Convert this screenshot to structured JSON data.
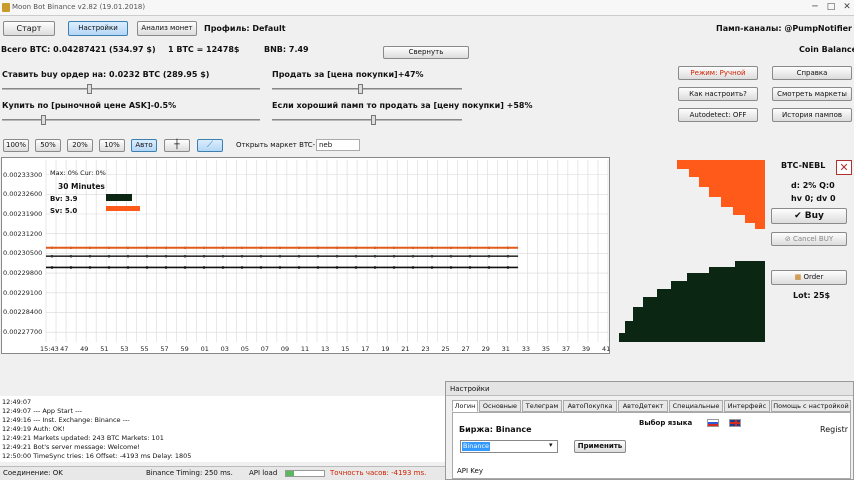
{
  "window": {
    "title": "Moon Bot Binance v2.82 (19.01.2018)"
  },
  "toolbar": {
    "start": "Старт",
    "settings": "Настройки",
    "analysis": "Анализ монет",
    "profile": "Профиль: Default",
    "pump_channels": "Памп-каналы: @PumpNotifier",
    "coin_balance": "Coin Balance"
  },
  "balance": {
    "total": "Всего BTC: 0.04287421 (534.97 $)",
    "rate": "1 BTC = 12478$",
    "bnb": "BNB: 7.49",
    "collapse": "Свернуть"
  },
  "params": {
    "buy_order": "Ставить buy ордер на: 0.0232 BTC  (289.95 $)",
    "sell_for": "Продать за [цена покупки]+47%",
    "buy_at": "Купить по [рыночной цене ASK]-0.5%",
    "good_pump": "Если хороший памп то продать за [цену покупки] +58%"
  },
  "sliders": {
    "buy_order": 0.33,
    "sell_for": 0.45,
    "buy_at": 0.15,
    "good_pump": 0.52
  },
  "side_buttons": {
    "mode": "Режим: Ручной",
    "help": "Справка",
    "howto": "Как настроить?",
    "markets": "Смотреть маркеты",
    "autodetect": "Autodetect: OFF",
    "history": "История пампов"
  },
  "chart_toolbar": {
    "pct": [
      "100%",
      "50%",
      "20%",
      "10%"
    ],
    "auto": "Авто",
    "open_market": "Открыть маркет BTC-",
    "market_value": "neb"
  },
  "chart_info": {
    "maxcur": "Max: 0%   Cur: 0%",
    "period": "30 Minutes",
    "bv": "Bv: 3.9",
    "sv": "Sv: 5.0"
  },
  "chart_data": {
    "type": "line",
    "y_ticks": [
      "0.00233300",
      "0.00232600",
      "0.00231900",
      "0.00231200",
      "0.00230500",
      "0.00229800",
      "0.00229100",
      "0.00228400",
      "0.00227700"
    ],
    "x_ticks": [
      "15:43",
      "47",
      "49",
      "51",
      "53",
      "55",
      "57",
      "59",
      "01",
      "03",
      "05",
      "07",
      "09",
      "11",
      "13",
      "15",
      "17",
      "19",
      "21",
      "23",
      "25",
      "27",
      "29",
      "31",
      "33",
      "35",
      "37",
      "39",
      "41"
    ],
    "ylim": [
      0.0022735,
      0.0023382
    ],
    "series": [
      {
        "color": "#e05a1a",
        "y": 0.002307,
        "x_extent": [
          0,
          0.84
        ]
      },
      {
        "color": "#333333",
        "y": 0.002304,
        "x_extent": [
          0,
          0.84
        ]
      },
      {
        "color": "#111111",
        "y": 0.0023,
        "x_extent": [
          0,
          0.84
        ]
      }
    ],
    "colors": {
      "sell": "#ff5a1a",
      "buy": "#0c2614"
    }
  },
  "right_panel": {
    "pair": "BTC-NEBL",
    "d_q": "d: 2% Q:0",
    "hv_dv": "hv 0; dv 0",
    "buy": "Buy",
    "cancel_buy": "Cancel BUY",
    "order": "Order",
    "lot": "Lot: 25$"
  },
  "log": [
    "12:49:07",
    "12:49:07        --- App Start ---",
    "12:49:16        --- Inst. Exchange: Binance ---",
    "12:49:19  Auth: OK!",
    "12:49:21  Markets updated: 243 BTC Markets: 101",
    "12:49:21  Bot's server message: Welcome!",
    "12:50:00  TimeSync tries: 16  Offset: -4193 ms Delay: 1805"
  ],
  "status": {
    "connection": "Соединение: OK",
    "timing": "Binance Timing: 250 ms.",
    "api_load": "API load",
    "accuracy": "Точность часов: -4193 ms."
  },
  "settings_window": {
    "title": "Настройки",
    "tabs": [
      "Логин",
      "Основные",
      "Телеграм",
      "АвтоПокупка",
      "АвтоДетект",
      "Специальные",
      "Интерфейс",
      "Помощь с настройкой"
    ],
    "exchange": "Биржа: Binance",
    "exchange_value": "Binance",
    "apply": "Применить",
    "lang": "Выбор языка",
    "register": "Registr",
    "api_key": "API Key"
  },
  "colors": {
    "accent": "#3c7fb1",
    "red": "#d02000"
  }
}
